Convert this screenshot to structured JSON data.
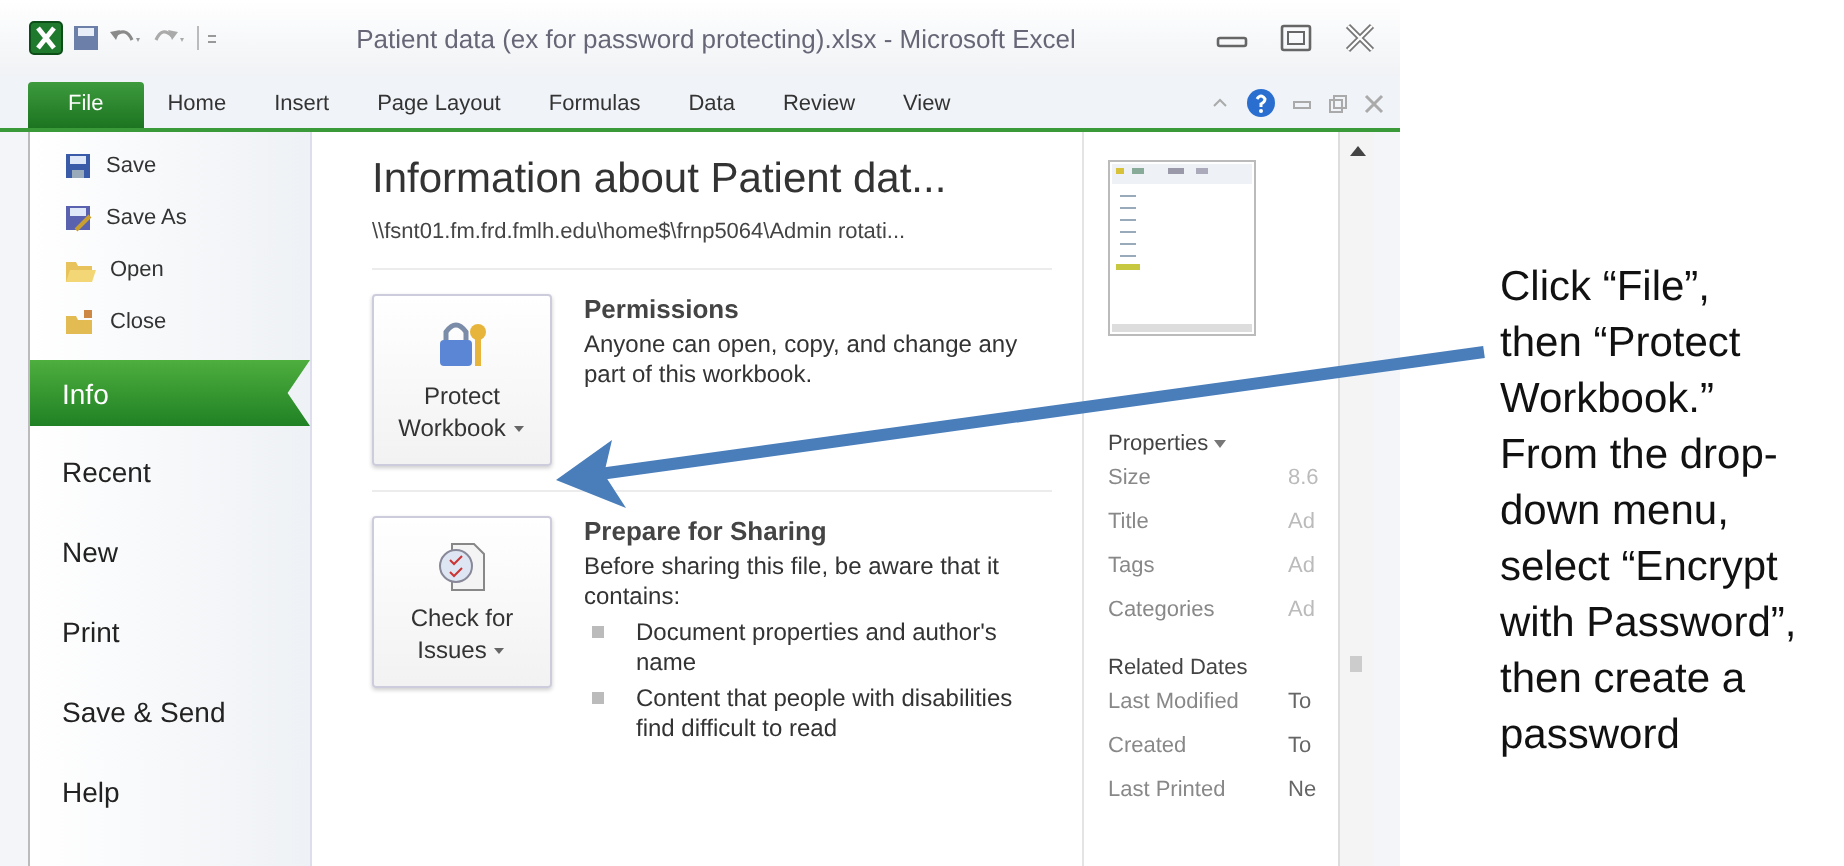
{
  "window": {
    "title": "Patient data (ex for password protecting).xlsx - Microsoft Excel"
  },
  "ribbon_tabs": [
    {
      "label": "File",
      "selected": true
    },
    {
      "label": "Home",
      "selected": false
    },
    {
      "label": "Insert",
      "selected": false
    },
    {
      "label": "Page Layout",
      "selected": false
    },
    {
      "label": "Formulas",
      "selected": false
    },
    {
      "label": "Data",
      "selected": false
    },
    {
      "label": "Review",
      "selected": false
    },
    {
      "label": "View",
      "selected": false
    }
  ],
  "backstage_nav": {
    "commands": [
      {
        "label": "Save",
        "kind": "save"
      },
      {
        "label": "Save As",
        "kind": "save-as"
      },
      {
        "label": "Open",
        "kind": "open"
      },
      {
        "label": "Close",
        "kind": "close"
      }
    ],
    "items": [
      {
        "label": "Info",
        "selected": true
      },
      {
        "label": "Recent",
        "selected": false
      },
      {
        "label": "New",
        "selected": false
      },
      {
        "label": "Print",
        "selected": false
      },
      {
        "label": "Save & Send",
        "selected": false
      },
      {
        "label": "Help",
        "selected": false
      }
    ]
  },
  "info": {
    "title": "Information about Patient dat...",
    "path": "\\\\fsnt01.fm.frd.fmlh.edu\\home$\\frnp5064\\Admin rotati...",
    "sections": [
      {
        "kind": "permissions",
        "button": "Protect Workbook",
        "heading": "Permissions",
        "text": "Anyone can open, copy, and change any part of this workbook."
      },
      {
        "kind": "sharing",
        "button": "Check for Issues",
        "heading": "Prepare for Sharing",
        "text": "Before sharing this file, be aware that it contains:",
        "bullets": [
          "Document properties and author's name",
          "Content that people with disabilities find difficult to read"
        ]
      }
    ]
  },
  "properties": {
    "heading": "Properties",
    "rows": [
      {
        "label": "Size",
        "value": "8.6"
      },
      {
        "label": "Title",
        "value": "Ad"
      },
      {
        "label": "Tags",
        "value": "Ad"
      },
      {
        "label": "Categories",
        "value": "Ad"
      }
    ]
  },
  "related_dates": {
    "heading": "Related Dates",
    "rows": [
      {
        "label": "Last Modified",
        "value": "To"
      },
      {
        "label": "Created",
        "value": "To"
      },
      {
        "label": "Last Printed",
        "value": "Ne"
      }
    ]
  },
  "annotation": {
    "lines": [
      "Click “File”,",
      "then  “Protect",
      "Workbook.”",
      "From the drop-",
      "down menu,",
      "select “Encrypt",
      "with Password”,",
      "then create a",
      "password"
    ]
  }
}
